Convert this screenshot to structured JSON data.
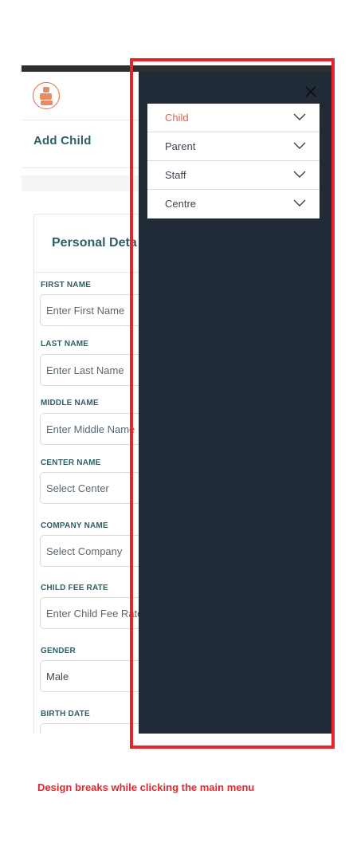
{
  "header": {
    "logo": "logo-icon",
    "page_title": "Add Child"
  },
  "form": {
    "section_title": "Personal Deta",
    "fields": [
      {
        "label": "FIRST NAME",
        "placeholder": "Enter First Name"
      },
      {
        "label": "LAST NAME",
        "placeholder": "Enter Last Name"
      },
      {
        "label": "MIDDLE NAME",
        "placeholder": "Enter Middle Name"
      },
      {
        "label": "CENTER NAME",
        "placeholder": "Select Center"
      },
      {
        "label": "COMPANY NAME",
        "placeholder": "Select Company"
      },
      {
        "label": "CHILD FEE RATE",
        "placeholder": "Enter Child Fee Rate"
      },
      {
        "label": "GENDER",
        "value": "Male"
      },
      {
        "label": "BIRTH DATE",
        "placeholder": ""
      }
    ]
  },
  "drawer": {
    "close_icon": "close-icon",
    "menu": [
      {
        "label": "Child",
        "active": true
      },
      {
        "label": "Parent",
        "active": false
      },
      {
        "label": "Staff",
        "active": false
      },
      {
        "label": "Centre",
        "active": false
      }
    ]
  },
  "annotation": {
    "caption": "Design breaks while clicking the main menu",
    "color": "#e4262c"
  },
  "colors": {
    "drawer_bg": "#212a37",
    "accent": "#e0624a",
    "heading": "#2f5f66"
  }
}
